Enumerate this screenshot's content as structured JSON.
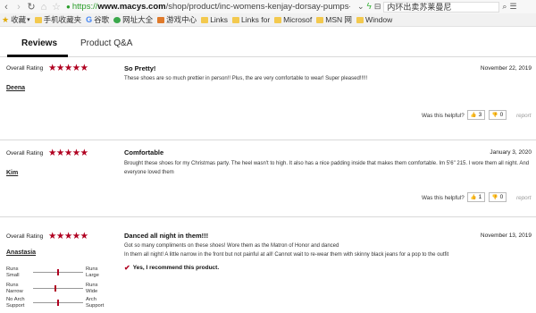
{
  "browser": {
    "url_scheme": "https://",
    "url_domain": "www.macys.com",
    "url_path": "/shop/product/inc-womens-kenjay-dorsay-pumps-created-fo",
    "search_text": "内环出卖苏莱曼尼",
    "bookmarks": [
      {
        "label": "收藏",
        "icon": "star-icon"
      },
      {
        "label": "手机收藏夹",
        "icon": "folder-icon"
      },
      {
        "label": "谷歌",
        "icon": "google-icon"
      },
      {
        "label": "网址大全",
        "icon": "globe-icon"
      },
      {
        "label": "游戏中心",
        "icon": "game-icon"
      },
      {
        "label": "Links",
        "icon": "folder-icon"
      },
      {
        "label": "Links for",
        "icon": "folder-icon"
      },
      {
        "label": "Microsof",
        "icon": "folder-icon"
      },
      {
        "label": "MSN 网",
        "icon": "folder-icon"
      },
      {
        "label": "Window",
        "icon": "folder-icon"
      }
    ]
  },
  "tabs": [
    {
      "label": "Reviews",
      "active": true
    },
    {
      "label": "Product Q&A",
      "active": false
    }
  ],
  "common": {
    "overall_rating_label": "Overall Rating",
    "stars": "★★★★★",
    "helpful_label": "Was this helpful?",
    "report_label": "report",
    "thumb_up": "👍",
    "thumb_down": "👎"
  },
  "reviews": [
    {
      "rating": 5,
      "author": "Deena",
      "title": "So Pretty!",
      "date": "November 22, 2019",
      "body": "These shoes are so much prettier in person!! Plus, the are very comfortable to wear! Super pleased!!!!!",
      "helpful_yes": "3",
      "helpful_no": "0"
    },
    {
      "rating": 5,
      "author": "Kim",
      "title": "Comfortable",
      "date": "January 3, 2020",
      "body": "Brought these shoes for my Christmas party. The heel wasn't to high. It also has a nice padding inside that makes them comfortable. Im 5'6\" 215. I wore them all night. And everyone loved them",
      "helpful_yes": "1",
      "helpful_no": "0"
    },
    {
      "rating": 5,
      "author": "Anastasia",
      "title": "Danced all night in them!!!",
      "date": "November 13, 2019",
      "body_line1": "Got so many compliments on these shoes! Wore them as the Matron of Honor and danced",
      "body_line2": "In them all night! A little narrow in the front but not painful at all! Cannot wait to re-wear them with skinny black jeans for a pop to the outfit",
      "recommend": "Yes, I recommend this product.",
      "fit": [
        {
          "left": "Runs Small",
          "right": "Runs Large",
          "value": 0.5
        },
        {
          "left": "Runs Narrow",
          "right": "Runs Wide",
          "value": 0.45
        },
        {
          "left": "No Arch Support",
          "right": "Arch Support",
          "value": 0.5
        }
      ]
    }
  ],
  "colors": {
    "star": "#b00020",
    "active_tab_underline": "#111111",
    "secure_url": "#2a9d2a"
  }
}
